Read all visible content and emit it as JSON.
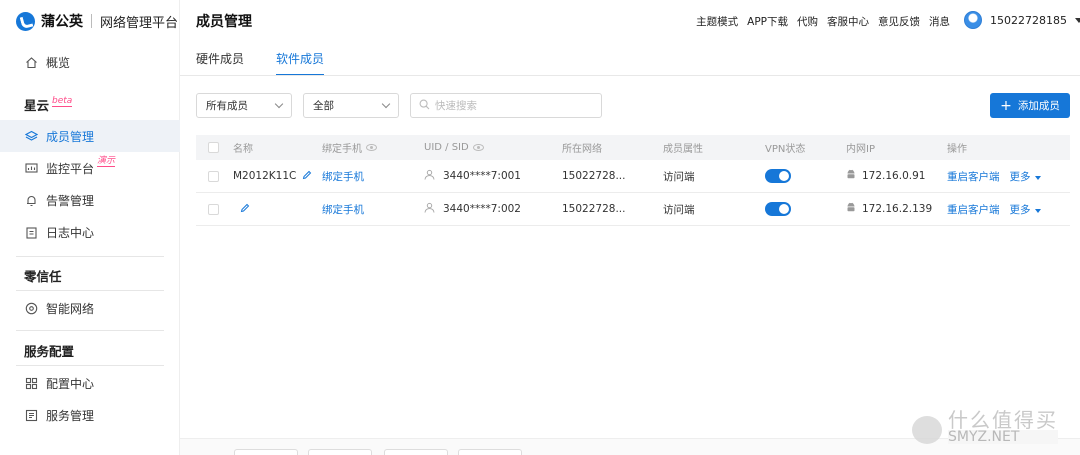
{
  "brand": {
    "name": "蒲公英",
    "subtitle": "网络管理平台"
  },
  "sidebar": {
    "overview": "概览",
    "groups": [
      {
        "title": "星云",
        "tag": "beta"
      },
      {
        "title": "零信任"
      },
      {
        "title": "服务配置"
      }
    ],
    "items": [
      {
        "label": "成员管理",
        "active": true
      },
      {
        "label": "监控平台",
        "tag": "演示"
      },
      {
        "label": "告警管理"
      },
      {
        "label": "日志中心"
      },
      {
        "label": "智能网络"
      },
      {
        "label": "配置中心"
      },
      {
        "label": "服务管理"
      }
    ]
  },
  "header": {
    "title": "成员管理",
    "links": [
      "主题模式",
      "APP下载",
      "代购",
      "客服中心",
      "意见反馈",
      "消息"
    ],
    "user": "15022728185"
  },
  "tabs": [
    {
      "label": "硬件成员",
      "active": false
    },
    {
      "label": "软件成员",
      "active": true
    }
  ],
  "filters": {
    "member_type": "所有成员",
    "scope": "全部",
    "search_placeholder": "快速搜索",
    "add_button": "添加成员"
  },
  "table": {
    "columns": [
      "名称",
      "绑定手机",
      "UID / SID",
      "所在网络",
      "成员属性",
      "VPN状态",
      "内网IP",
      "操作"
    ],
    "rows": [
      {
        "name": "M2012K11C",
        "phone": "绑定手机",
        "uid": "3440****7:001",
        "network": "15022728...",
        "attr": "访问端",
        "vpn_on": true,
        "ip": "172.16.0.91",
        "action": "重启客户端",
        "more": "更多"
      },
      {
        "name": "",
        "phone": "绑定手机",
        "uid": "3440****7:002",
        "network": "15022728...",
        "attr": "访问端",
        "vpn_on": true,
        "ip": "172.16.2.139",
        "action": "重启客户端",
        "more": "更多"
      }
    ]
  },
  "watermark": {
    "cn": "什么值得买",
    "en": "SMYZ.NET"
  },
  "colors": {
    "accent": "#1677d8",
    "tag": "#ff4d8a"
  }
}
